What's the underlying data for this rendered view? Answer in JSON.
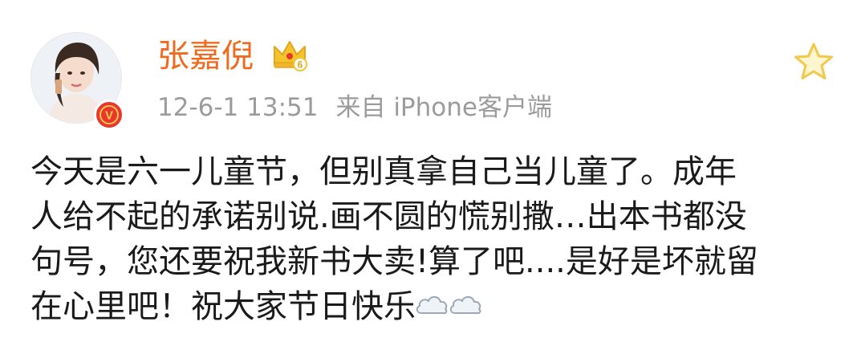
{
  "post": {
    "author_name": "张嘉倪",
    "member_level": "6",
    "timestamp": "12-6-1 13:51",
    "source": "来自 iPhone客户端",
    "content_lines": [
      "今天是六一儿童节，但别真拿自己当儿童了。成年",
      "人给不起的承诺别说.画不圆的慌别撒…出本书都没",
      "句号，您还要祝我新书大卖!算了吧....是好是坏就留",
      "在心里吧！祝大家节日快乐"
    ],
    "verified_badge_letter": "V",
    "emoji": [
      "cloud-icon",
      "cloud-icon"
    ]
  },
  "colors": {
    "username": "#f06a1e",
    "meta_text": "#9b9b9b",
    "body_text": "#1a1a1a",
    "verified_badge": "#e8382e",
    "crown": "#f5c42c",
    "star": "#f2c84b"
  }
}
